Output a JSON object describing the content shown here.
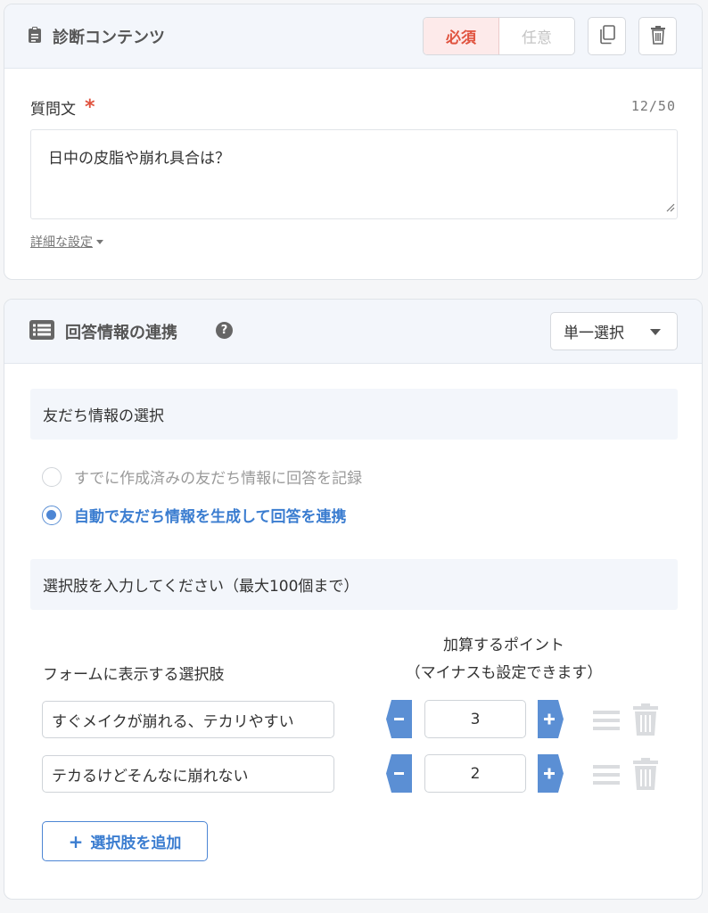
{
  "diagnosis": {
    "title": "診断コンテンツ",
    "required_label": "必須",
    "optional_label": "任意",
    "question_label": "質問文",
    "required_mark": "*",
    "char_count": "12/50",
    "question_text": "日中の皮脂や崩れ具合は？",
    "advanced_link": "詳細な設定"
  },
  "answer": {
    "title": "回答情報の連携",
    "help_mark": "?",
    "select_value": "単一選択",
    "friend_section": "友だち情報の選択",
    "radio_existing": "すでに作成済みの友だち情報に回答を記録",
    "radio_auto": "自動で友だち情報を生成して回答を連携",
    "selected_radio": "auto",
    "choices_section": "選択肢を入力してください（最大100個まで）",
    "col_choice": "フォームに表示する選択肢",
    "col_points_line1": "加算するポイント",
    "col_points_line2": "（マイナスも設定できます）",
    "options": [
      {
        "label": "すぐメイクが崩れる、テカリやすい",
        "points": "3"
      },
      {
        "label": "テカるけどそんなに崩れない",
        "points": "2"
      }
    ],
    "add_label": "選択肢を追加",
    "add_icon": "+"
  },
  "colors": {
    "accent_blue": "#4d86d4",
    "required_red": "#e0533f",
    "header_bg": "#f3f6fb"
  }
}
